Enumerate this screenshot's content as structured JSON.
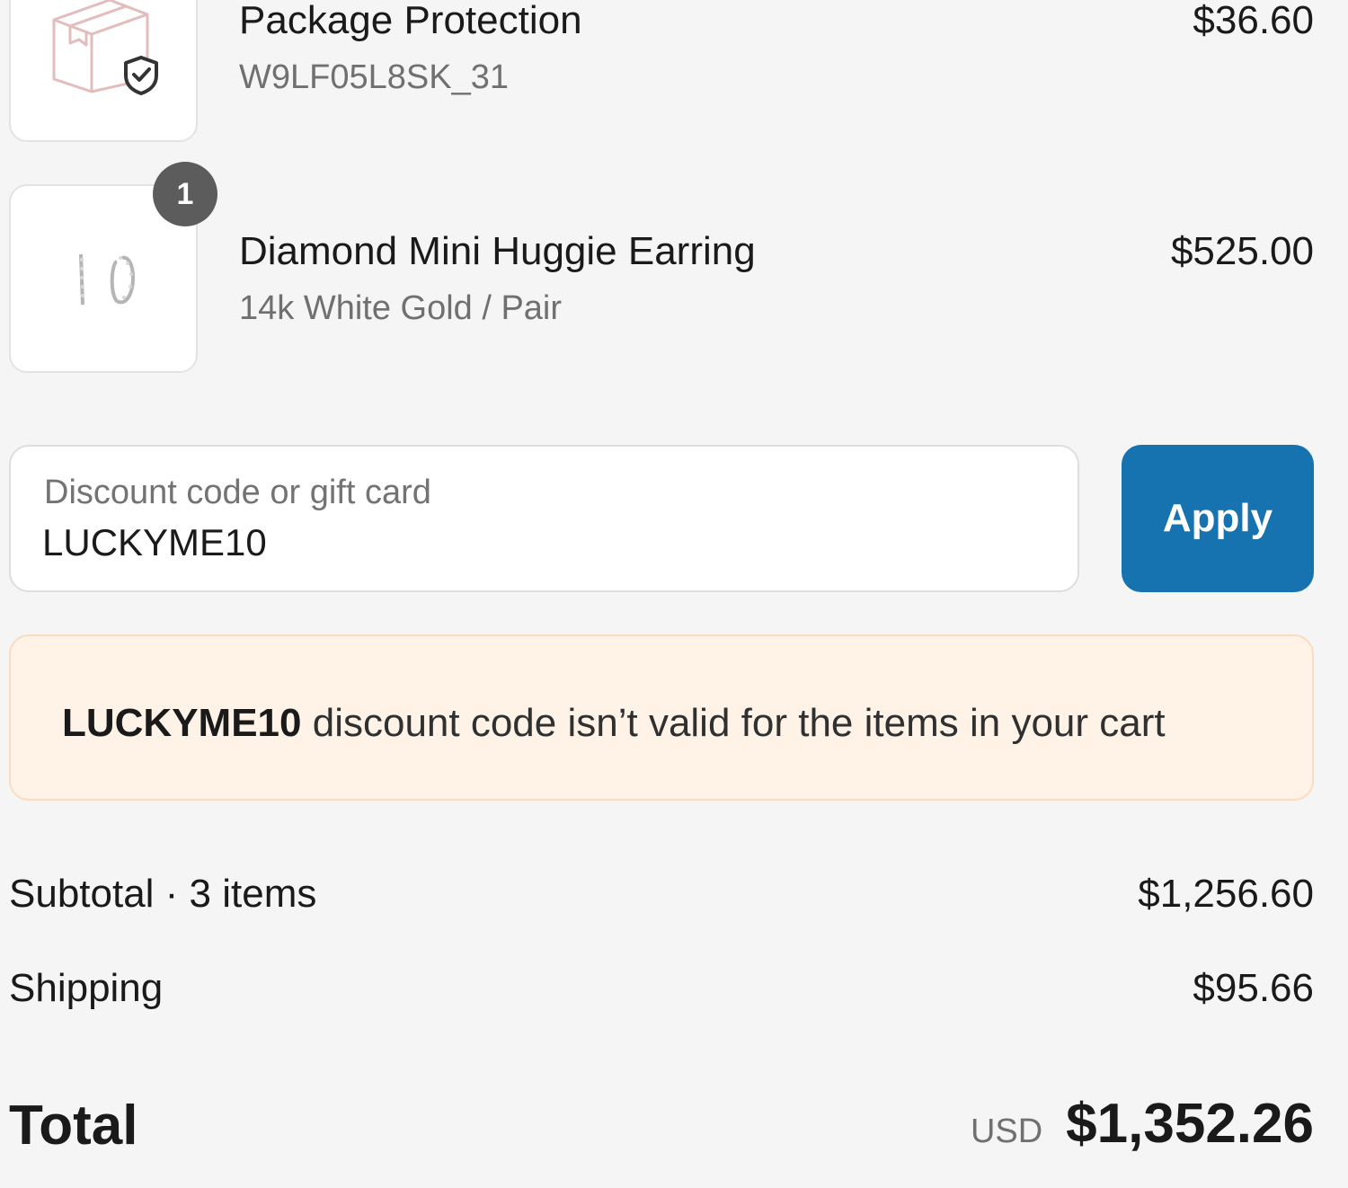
{
  "line_items": [
    {
      "title": "Package Protection",
      "subtitle": "W9LF05L8SK_31",
      "price": "$36.60",
      "image_icon": "package-shield-icon"
    },
    {
      "title": "Diamond Mini Huggie Earring",
      "subtitle": "14k White Gold / Pair",
      "price": "$525.00",
      "quantity": "1",
      "image_icon": "earring-image"
    }
  ],
  "discount": {
    "label": "Discount code or gift card",
    "value": "LUCKYME10",
    "apply_label": "Apply"
  },
  "error_banner": {
    "code": "LUCKYME10",
    "message": " discount code isn’t valid for the items in your cart"
  },
  "summary": {
    "subtotal_label": "Subtotal · 3 items",
    "subtotal_value": "$1,256.60",
    "shipping_label": "Shipping",
    "shipping_value": "$95.66",
    "total_label": "Total",
    "currency": "USD",
    "total_value": "$1,352.26"
  },
  "colors": {
    "accent": "#1773b0",
    "background": "#f5f5f5",
    "warning_bg": "#fff2e6",
    "warning_border": "#fbdcc0",
    "badge": "#5c5c5c"
  }
}
